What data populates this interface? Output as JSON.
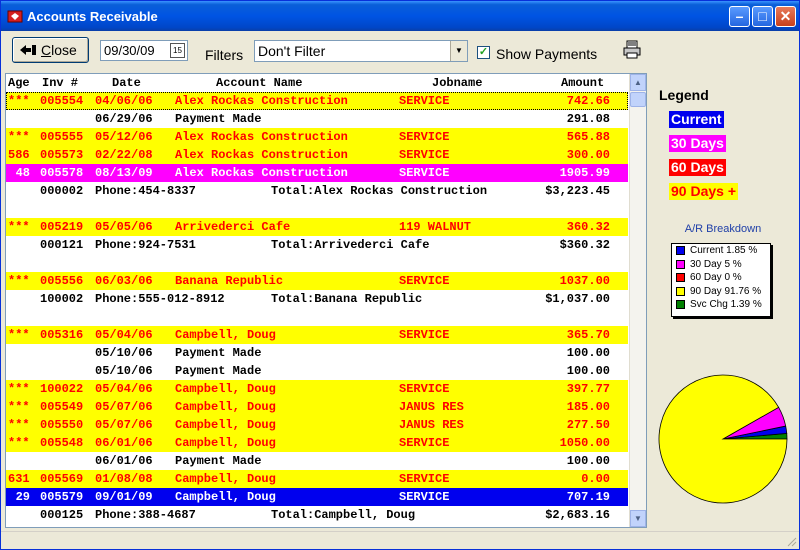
{
  "window": {
    "title": "Accounts Receivable"
  },
  "toolbar": {
    "close_label_underlined": "C",
    "close_label_rest": "lose",
    "date_value": "09/30/09",
    "calendar_icon_text": "15",
    "filters_label": "Filters",
    "filter_value": "Don't Filter",
    "show_payments_checked": true,
    "show_payments_label": "Show Payments"
  },
  "columns": {
    "age": "Age",
    "inv": "Inv #",
    "date": "Date",
    "name": "Account Name",
    "job": "Jobname",
    "amount": "Amount"
  },
  "colors": {
    "current": "#0000ee",
    "d30": "#ff00ff",
    "d60": "#ff0000",
    "d90": "#ffff00",
    "red_text": "#ff0000",
    "white_text": "#ffffff",
    "black_text": "#000000"
  },
  "rows": [
    {
      "kind": "inv",
      "bg": "#ffff00",
      "fg": "#ff0000",
      "age": "***",
      "inv": "005554",
      "date": "04/06/06",
      "name": "Alex Rockas Construction",
      "job": "SERVICE",
      "amt": "742.66",
      "selected": true
    },
    {
      "kind": "pay",
      "date": "06/29/06",
      "name": "Payment Made",
      "amt": "291.08"
    },
    {
      "kind": "inv",
      "bg": "#ffff00",
      "fg": "#ff0000",
      "age": "***",
      "inv": "005555",
      "date": "05/12/06",
      "name": "Alex Rockas Construction",
      "job": "SERVICE",
      "amt": "565.88"
    },
    {
      "kind": "inv",
      "bg": "#ffff00",
      "fg": "#ff0000",
      "age": "586",
      "inv": "005573",
      "date": "02/22/08",
      "name": "Alex Rockas Construction",
      "job": "SERVICE",
      "amt": "300.00"
    },
    {
      "kind": "inv",
      "bg": "#ff00ff",
      "fg": "#ffffff",
      "age": "48",
      "inv": "005578",
      "date": "08/13/09",
      "name": "Alex Rockas Construction",
      "job": "SERVICE",
      "amt": "1905.99"
    },
    {
      "kind": "total",
      "acct": "000002",
      "phone": "Phone:454-8337",
      "total": "Total:Alex Rockas Construction",
      "amt": "$3,223.45"
    },
    {
      "kind": "blank"
    },
    {
      "kind": "inv",
      "bg": "#ffff00",
      "fg": "#ff0000",
      "age": "***",
      "inv": "005219",
      "date": "05/05/06",
      "name": "Arrivederci Cafe",
      "job": "119 WALNUT",
      "amt": "360.32"
    },
    {
      "kind": "total",
      "acct": "000121",
      "phone": "Phone:924-7531",
      "total": "Total:Arrivederci Cafe",
      "amt": "$360.32"
    },
    {
      "kind": "blank"
    },
    {
      "kind": "inv",
      "bg": "#ffff00",
      "fg": "#ff0000",
      "age": "***",
      "inv": "005556",
      "date": "06/03/06",
      "name": "Banana Republic",
      "job": "SERVICE",
      "amt": "1037.00"
    },
    {
      "kind": "total",
      "acct": "100002",
      "phone": "Phone:555-012-8912",
      "total": "Total:Banana Republic",
      "amt": "$1,037.00"
    },
    {
      "kind": "blank"
    },
    {
      "kind": "inv",
      "bg": "#ffff00",
      "fg": "#ff0000",
      "age": "***",
      "inv": "005316",
      "date": "05/04/06",
      "name": "Campbell, Doug",
      "job": "SERVICE",
      "amt": "365.70"
    },
    {
      "kind": "pay",
      "date": "05/10/06",
      "name": "Payment Made",
      "amt": "100.00"
    },
    {
      "kind": "pay",
      "date": "05/10/06",
      "name": "Payment Made",
      "amt": "100.00"
    },
    {
      "kind": "inv",
      "bg": "#ffff00",
      "fg": "#ff0000",
      "age": "***",
      "inv": "100022",
      "date": "05/04/06",
      "name": "Campbell, Doug",
      "job": "SERVICE",
      "amt": "397.77"
    },
    {
      "kind": "inv",
      "bg": "#ffff00",
      "fg": "#ff0000",
      "age": "***",
      "inv": "005549",
      "date": "05/07/06",
      "name": "Campbell, Doug",
      "job": "JANUS RES",
      "amt": "185.00"
    },
    {
      "kind": "inv",
      "bg": "#ffff00",
      "fg": "#ff0000",
      "age": "***",
      "inv": "005550",
      "date": "05/07/06",
      "name": "Campbell, Doug",
      "job": "JANUS RES",
      "amt": "277.50"
    },
    {
      "kind": "inv",
      "bg": "#ffff00",
      "fg": "#ff0000",
      "age": "***",
      "inv": "005548",
      "date": "06/01/06",
      "name": "Campbell, Doug",
      "job": "SERVICE",
      "amt": "1050.00"
    },
    {
      "kind": "pay",
      "date": "06/01/06",
      "name": "Payment Made",
      "amt": "100.00"
    },
    {
      "kind": "inv",
      "bg": "#ffff00",
      "fg": "#ff0000",
      "age": "631",
      "inv": "005569",
      "date": "01/08/08",
      "name": "Campbell, Doug",
      "job": "SERVICE",
      "amt": "0.00"
    },
    {
      "kind": "inv",
      "bg": "#0000ee",
      "fg": "#ffffff",
      "age": "29",
      "inv": "005579",
      "date": "09/01/09",
      "name": "Campbell, Doug",
      "job": "SERVICE",
      "amt": "707.19"
    },
    {
      "kind": "total",
      "acct": "000125",
      "phone": "Phone:388-4687",
      "total": "Total:Campbell, Doug",
      "amt": "$2,683.16"
    }
  ],
  "legend": {
    "title": "Legend",
    "items": [
      {
        "label": "Current",
        "bg": "#0000ee",
        "fg": "#ffffff"
      },
      {
        "label": "30 Days",
        "bg": "#ff00ff",
        "fg": "#ffffff"
      },
      {
        "label": "60 Days",
        "bg": "#ff0000",
        "fg": "#ffffff"
      },
      {
        "label": "90 Days +",
        "bg": "#ffff00",
        "fg": "#ff0000"
      }
    ]
  },
  "breakdown": {
    "title": "A/R Breakdown",
    "items": [
      {
        "label": "Current 1.85 %",
        "color": "#0000ee",
        "value": 1.85
      },
      {
        "label": "30 Day 5 %",
        "color": "#ff00ff",
        "value": 5
      },
      {
        "label": "60 Day 0 %",
        "color": "#ff0000",
        "value": 0
      },
      {
        "label": "90 Day 91.76 %",
        "color": "#ffff00",
        "value": 91.76
      },
      {
        "label": "Svc Chg 1.39 %",
        "color": "#008000",
        "value": 1.39
      }
    ]
  }
}
